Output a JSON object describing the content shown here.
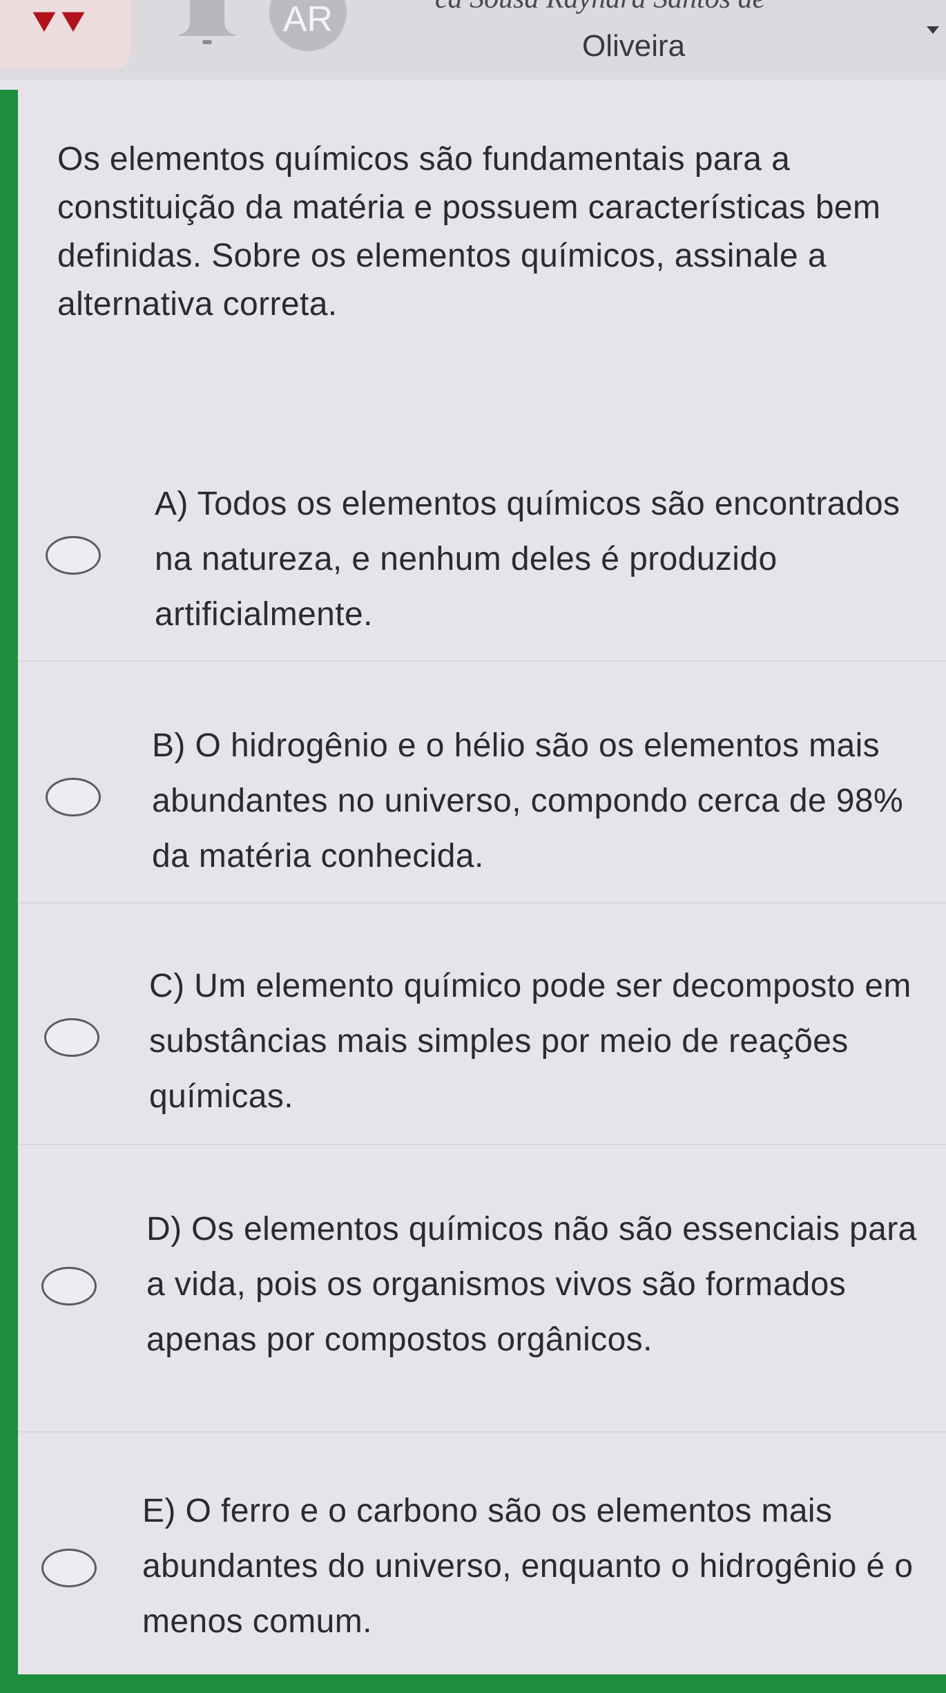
{
  "header": {
    "avatar_initials": "AR",
    "user_name_partial": "ca Sousa Rayhara Santos de",
    "user_name": "Oliveira",
    "icons": [
      "flag-icon",
      "bell-icon",
      "chevron-down-icon"
    ]
  },
  "question": {
    "text": "Os elementos químicos são fundamentais para a constituição da matéria e possuem características bem definidas. Sobre os elementos químicos, assinale a alternativa correta."
  },
  "options": [
    {
      "label": "A) Todos os elementos químicos são encontrados na natureza, e nenhum deles é produzido artificialmente."
    },
    {
      "label": "B) O hidrogênio e o hélio são os elementos mais abundantes no universo, compondo cerca de 98% da matéria conhecida."
    },
    {
      "label": "C) Um elemento químico pode ser decomposto em substâncias mais simples por meio de reações químicas."
    },
    {
      "label": "D) Os elementos químicos não são essenciais para a vida, pois os organismos vivos são formados apenas por compostos orgânicos."
    },
    {
      "label": "E) O ferro e o carbono são os elementos mais abundantes do universo, enquanto o hidrogênio é o menos comum."
    }
  ],
  "colors": {
    "accent": "#1e8f3c",
    "flag": "#b1121d",
    "background": "#e6e4e9"
  }
}
